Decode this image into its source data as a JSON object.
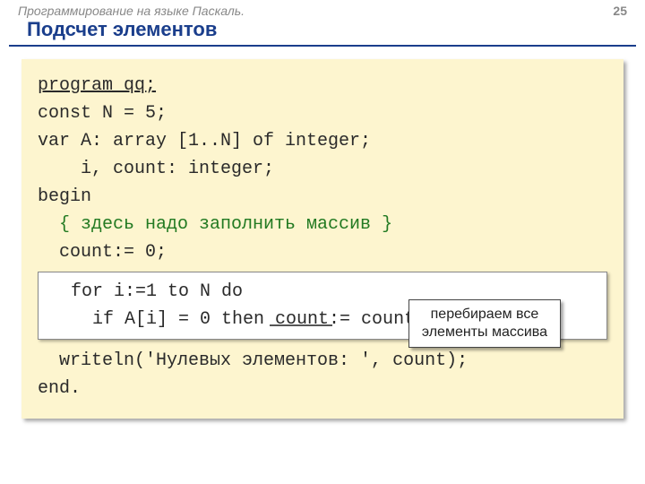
{
  "header": {
    "subject": "Программирование на языке Паскаль.",
    "page_number": "25"
  },
  "title": "Подсчет элементов",
  "code": {
    "l1": "program qq;",
    "l2": "const N = 5;",
    "l3": "var A: array [1..N] of integer;",
    "l4": "    i, count: integer;",
    "l5": "begin",
    "l6": "  { здесь надо заполнить массив }",
    "l7": "  count:= 0;",
    "l8": "  for i:=1 to N do",
    "l9": "    if A[i] = 0 then count:= count + 1;",
    "l10": "  writeln('Нулевых элементов: ', count);",
    "l11": "end."
  },
  "callout": {
    "line1": "перебираем все",
    "line2": "элементы массива"
  }
}
